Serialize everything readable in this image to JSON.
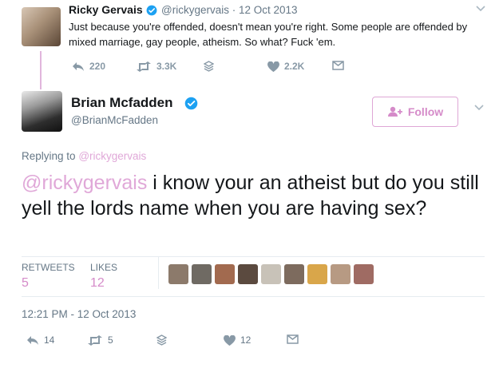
{
  "parent_tweet": {
    "name": "Ricky Gervais",
    "handle": "@rickygervais",
    "date_sep": "·",
    "date": "12 Oct 2013",
    "text": "Just because you're offended, doesn't mean you're right. Some people are offended by mixed marriage, gay people, atheism. So what? Fuck 'em.",
    "replies": "220",
    "retweets": "3.3K",
    "likes": "2.2K"
  },
  "main_tweet": {
    "name": "Brian Mcfadden",
    "handle": "@BrianMcFadden",
    "follow_label": "Follow",
    "replying_prefix": "Replying to",
    "replying_handle": "@rickygervais",
    "mention": "@rickygervais",
    "text": " i know your an atheist but do you still yell the lords name when you are having sex?",
    "retweets_label": "RETWEETS",
    "retweets_count": "5",
    "likes_label": "LIKES",
    "likes_count": "12",
    "timestamp": "12:21 PM - 12 Oct 2013",
    "action_replies": "14",
    "action_retweets": "5",
    "action_likes": "12"
  },
  "icons": {
    "verified": "verified-badge-icon",
    "reply": "reply-icon",
    "retweet": "retweet-icon",
    "stack": "layers-icon",
    "like": "heart-icon",
    "dm": "envelope-icon",
    "caret": "chevron-down-icon",
    "follow": "add-user-icon"
  },
  "colors": {
    "accent": "#d58bc9",
    "verified": "#1da1f2",
    "muted": "#657786"
  },
  "likers": [
    "#8c7a6b",
    "#6f6a63",
    "#a26a4f",
    "#5b4a3f",
    "#c8c2b8",
    "#7d6b5e",
    "#d9a64a",
    "#b79a83",
    "#9f6b63"
  ]
}
